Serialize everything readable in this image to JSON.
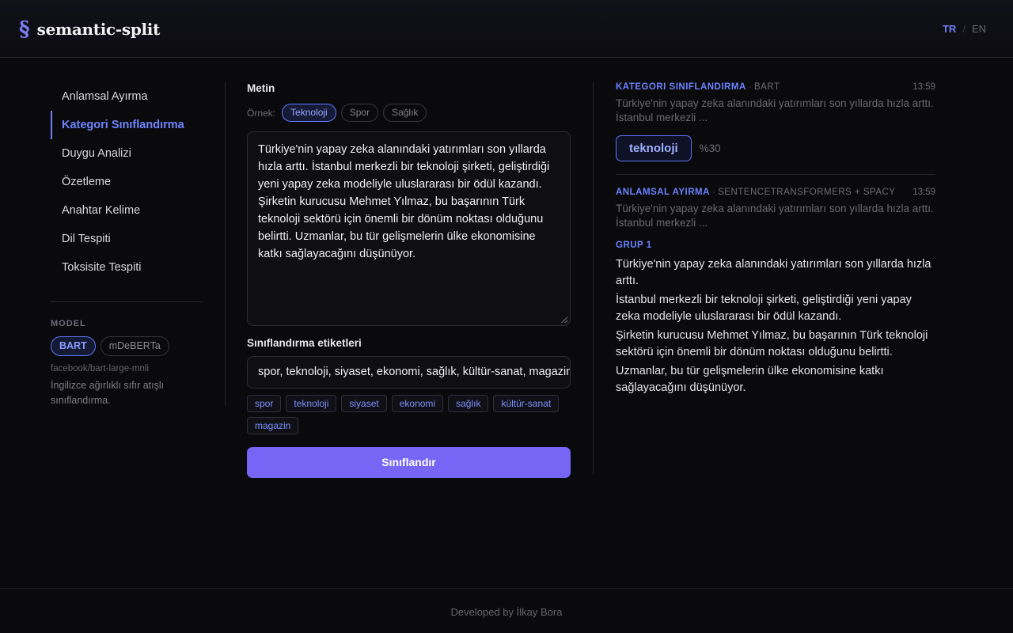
{
  "brand": {
    "mark": "§",
    "name": "semantic-split"
  },
  "lang": {
    "active": "TR",
    "separator": "/",
    "other": "EN"
  },
  "sidebar": {
    "items": [
      {
        "label": "Anlamsal Ayırma"
      },
      {
        "label": "Kategori Sınıflandırma"
      },
      {
        "label": "Duygu Analizi"
      },
      {
        "label": "Özetleme"
      },
      {
        "label": "Anahtar Kelime"
      },
      {
        "label": "Dil Tespiti"
      },
      {
        "label": "Toksisite Tespiti"
      }
    ],
    "active_index": 1,
    "model_title": "MODEL",
    "models": [
      "BART",
      "mDeBERTa"
    ],
    "active_model": "BART",
    "model_id": "facebook/bart-large-mnli",
    "model_desc": "İngilizce ağırlıklı sıfır atışlı sınıflandırma."
  },
  "main": {
    "text_label": "Metin",
    "examples_label": "Örnek:",
    "examples": [
      "Teknoloji",
      "Spor",
      "Sağlık"
    ],
    "active_example": "Teknoloji",
    "text_value": "Türkiye'nin yapay zeka alanındaki yatırımları son yıllarda hızla arttı. İstanbul merkezli bir teknoloji şirketi, geliştirdiği yeni yapay zeka modeliyle uluslararası bir ödül kazandı. Şirketin kurucusu Mehmet Yılmaz, bu başarının Türk teknoloji sektörü için önemli bir dönüm noktası olduğunu belirtti. Uzmanlar, bu tür gelişmelerin ülke ekonomisine katkı sağlayacağını düşünüyor.",
    "labels_title": "Sınıflandırma etiketleri",
    "labels_value": "spor, teknoloji, siyaset, ekonomi, sağlık, kültür-sanat, magazin",
    "tags": [
      "spor",
      "teknoloji",
      "siyaset",
      "ekonomi",
      "sağlık",
      "kültür-sanat",
      "magazin"
    ],
    "submit_label": "Sınıflandır"
  },
  "results": {
    "classification": {
      "task": "KATEGORI SINIFLANDIRMA",
      "dot": "·",
      "model": "BART",
      "time": "13:59",
      "snippet": "Türkiye'nin yapay zeka alanındaki yatırımları son yıllarda hızla arttı. İstanbul merkezli ...",
      "label": "teknoloji",
      "score": "%30"
    },
    "semantic": {
      "task": "ANLAMSAL AYIRMA",
      "dot": "·",
      "model": "SENTENCETRANSFORMERS + SPACY",
      "time": "13:59",
      "snippet": "Türkiye'nin yapay zeka alanındaki yatırımları son yıllarda hızla arttı. İstanbul merkezli ...",
      "group_title": "GRUP 1",
      "sentences": [
        "Türkiye'nin yapay zeka alanındaki yatırımları son yıllarda hızla arttı.",
        "İstanbul merkezli bir teknoloji şirketi, geliştirdiği yeni yapay zeka modeliyle uluslararası bir ödül kazandı.",
        "Şirketin kurucusu Mehmet Yılmaz, bu başarının Türk teknoloji sektörü için önemli bir dönüm noktası olduğunu belirtti.",
        "Uzmanlar, bu tür gelişmelerin ülke ekonomisine katkı sağlayacağını düşünüyor."
      ]
    }
  },
  "footer": {
    "text": "Developed by İlkay Bora"
  },
  "colors": {
    "accent": "#6f7cf8",
    "button": "#7766f5",
    "background": "#0a0a0d"
  }
}
